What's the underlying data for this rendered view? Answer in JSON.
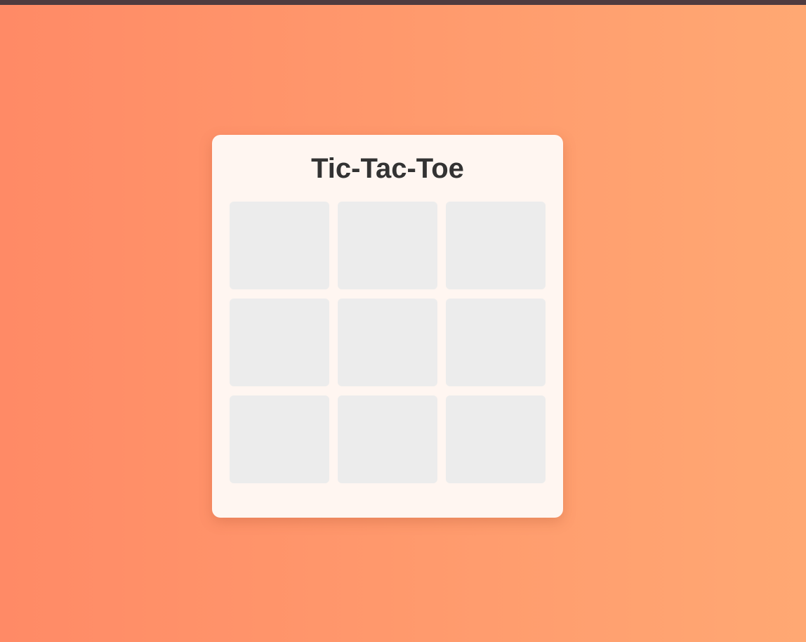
{
  "game": {
    "title": "Tic-Tac-Toe",
    "board": [
      "",
      "",
      "",
      "",
      "",
      "",
      "",
      "",
      ""
    ]
  },
  "colors": {
    "background_start": "#ff8a66",
    "background_end": "#ffa873",
    "card": "#fff6f1",
    "cell": "#ececec",
    "title_text": "#333333",
    "top_bar": "#4f3b3f"
  }
}
